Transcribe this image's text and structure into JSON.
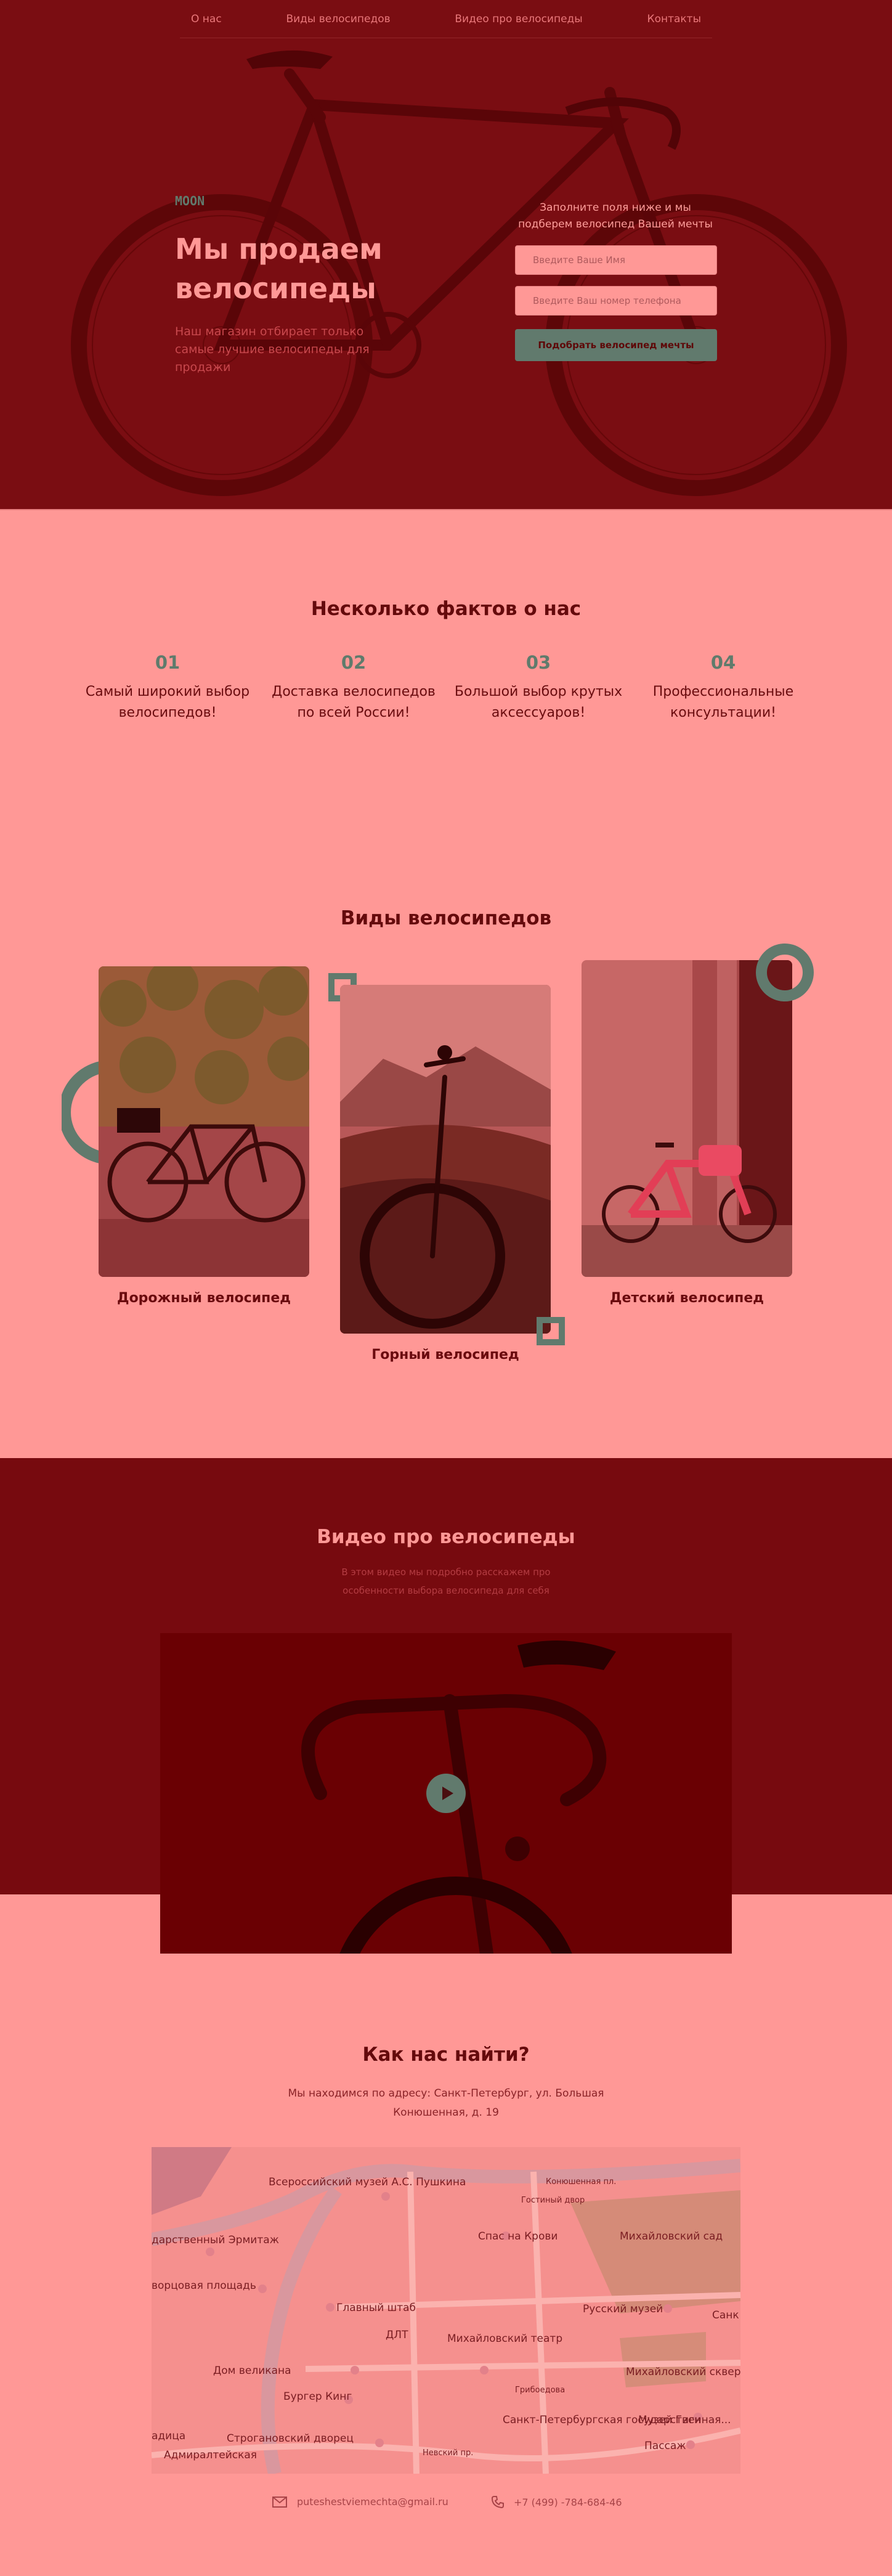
{
  "nav": {
    "items": [
      "О нас",
      "Виды велосипедов",
      "Видео про велосипеды",
      "Контакты"
    ]
  },
  "hero": {
    "logo_text": "MOON",
    "title": "Мы продаем велосипеды",
    "subtitle": "Наш магазин отбирает только самые лучшие велосипеды для продажи",
    "form_title": "Заполните поля ниже и мы подберем велосипед Вашей мечты",
    "name_placeholder": "Введите Ваше Имя",
    "phone_placeholder": "Введите Ваш номер телефона",
    "cta_label": "Подобрать велосипед мечты"
  },
  "facts": {
    "title": "Несколько фактов о нас",
    "items": [
      {
        "num": "01",
        "text": "Самый широкий выбор велосипедов!"
      },
      {
        "num": "02",
        "text": "Доставка велосипедов по всей России!"
      },
      {
        "num": "03",
        "text": "Большой выбор крутых аксессуаров!"
      },
      {
        "num": "04",
        "text": "Профессиональные консультации!"
      }
    ]
  },
  "types": {
    "title": "Виды велосипедов",
    "items": [
      {
        "label": "Дорожный велосипед"
      },
      {
        "label": "Горный велосипед"
      },
      {
        "label": "Детский велосипед"
      }
    ]
  },
  "video": {
    "title": "Видео про велосипеды",
    "subtitle": "В этом видео мы подробно расскажем про особенности выбора велосипеда для себя"
  },
  "contacts": {
    "title": "Как нас найти?",
    "address": "Мы находимся по адресу: Санкт-Петербург, ул. Большая Конюшенная, д. 19",
    "email": "puteshestviemechta@gmail.ru",
    "phone": "+7 (499) -784-684-46",
    "map_labels": [
      "Всероссийский музей А.С. Пушкина",
      "дарственный Эрмитаж",
      "ворцовая площадь",
      "Главный штаб",
      "Спас на Крови",
      "Михайловский сад",
      "Русский музей",
      "ДЛТ",
      "Михайловский театр",
      "Михайловский сквер",
      "Дом великана",
      "Бургер Кинг",
      "Строгановский дворец",
      "Адмиралтейская",
      "Санкт-Петербургская государственная...",
      "Музей Гиги",
      "Пассаж",
      "Невский пр.",
      "Гостиный двор",
      "Конюшенная пл.",
      "Санк",
      "Грибоедова",
      "адица"
    ]
  },
  "colors": {
    "brand_dark": "#770a0f",
    "brand_light": "#ff9896",
    "accent": "#617a6d"
  }
}
